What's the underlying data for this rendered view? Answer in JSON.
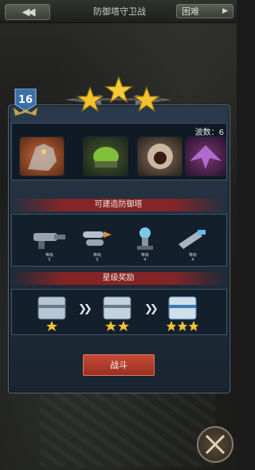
{
  "header": {
    "title": "防御塔守卫战",
    "difficulty": "困难",
    "back_icon": "double-chevron-left-icon",
    "difficulty_arrow_icon": "triangle-right-icon"
  },
  "stage": {
    "level": "16",
    "stars": 3
  },
  "monsters": {
    "wave_label": "波数：6",
    "items": [
      "monster-dragon",
      "monster-mech",
      "monster-maw",
      "monster-bat"
    ]
  },
  "towers": {
    "section_title": "可建造防御塔",
    "items": [
      {
        "icon": "gatling-tower-icon",
        "level": "等级",
        "level_value": "5"
      },
      {
        "icon": "missile-tower-icon",
        "level": "等级",
        "level_value": "5"
      },
      {
        "icon": "tesla-tower-icon",
        "level": "等级",
        "level_value": "4"
      },
      {
        "icon": "laser-tower-icon",
        "level": "等级",
        "level_value": "4"
      }
    ]
  },
  "rewards": {
    "section_title": "星级奖励",
    "items": [
      {
        "icon": "supply-chest-icon",
        "stars": 1
      },
      {
        "icon": "supply-chest-icon",
        "stars": 2
      },
      {
        "icon": "supply-chest-icon",
        "stars": 3
      }
    ]
  },
  "actions": {
    "fight_label": "战斗"
  },
  "colors": {
    "accent": "#b03a2a",
    "star": "#f2c230",
    "panel": "#24344a"
  }
}
